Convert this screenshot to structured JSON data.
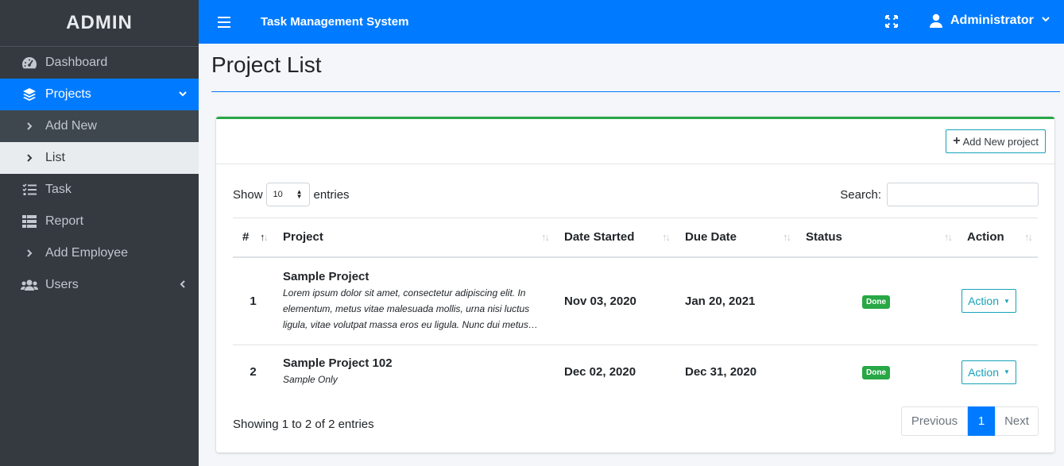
{
  "sidebar": {
    "brand": "ADMIN",
    "items": [
      {
        "label": "Dashboard",
        "icon": "tachometer-icon"
      },
      {
        "label": "Projects",
        "icon": "layers-icon"
      },
      {
        "label": "Add New",
        "icon": "chevron-right-icon"
      },
      {
        "label": "List",
        "icon": "chevron-right-icon"
      },
      {
        "label": "Task",
        "icon": "tasks-icon"
      },
      {
        "label": "Report",
        "icon": "table-icon"
      },
      {
        "label": "Add Employee",
        "icon": "chevron-right-icon"
      },
      {
        "label": "Users",
        "icon": "users-icon"
      }
    ]
  },
  "topbar": {
    "title": "Task Management System",
    "user": "Administrator"
  },
  "page": {
    "title": "Project List"
  },
  "card": {
    "add_button": "Add New project",
    "show_label": "Show",
    "entries_label": "entries",
    "page_length": "10",
    "search_label": "Search:",
    "search_value": ""
  },
  "table": {
    "columns": [
      "#",
      "Project",
      "Date Started",
      "Due Date",
      "Status",
      "Action"
    ],
    "rows": [
      {
        "num": "1",
        "name": "Sample Project",
        "desc": "Lorem ipsum dolor sit amet, consectetur adipiscing elit. In elementum, metus vitae malesuada mollis, urna nisi luctus ligula, vitae volutpat massa eros eu ligula. Nunc dui metus…",
        "started": "Nov 03, 2020",
        "due": "Jan 20, 2021",
        "status": "Done",
        "action": "Action"
      },
      {
        "num": "2",
        "name": "Sample Project 102",
        "desc": "Sample Only",
        "started": "Dec 02, 2020",
        "due": "Dec 31, 2020",
        "status": "Done",
        "action": "Action"
      }
    ]
  },
  "footer": {
    "info": "Showing 1 to 2 of 2 entries",
    "prev": "Previous",
    "page": "1",
    "next": "Next"
  },
  "colors": {
    "primary": "#007bff",
    "sidebar": "#343a40",
    "success": "#28a745",
    "info": "#17a2b8"
  }
}
